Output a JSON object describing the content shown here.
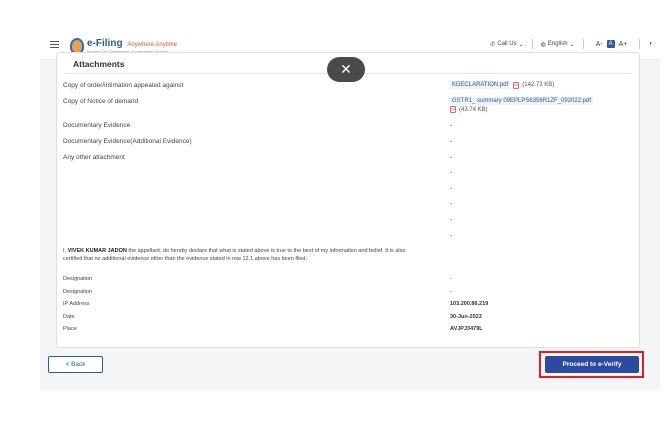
{
  "header": {
    "logo_title": "e-Filing",
    "logo_tagline": "Anywhere Anytime",
    "logo_subtitle": "Income Tax Department, Government of India",
    "call_us": "Call Us",
    "language": "English",
    "font_decrease": "A-",
    "font_normal": "A",
    "font_increase": "A+"
  },
  "card": {
    "title": "Attachments"
  },
  "attachments": [
    {
      "label": "Copy of order/intimation appealed against",
      "file": "KDECLARATION.pdf",
      "size": "(142.73 KB)"
    },
    {
      "label": "Copy of Notice of demand",
      "file": "GSTR1_ summary 09EPLPS6356R1ZF_092022.pdf",
      "size": "(43.74 KB)"
    },
    {
      "label": "Documentary Evidence",
      "value": "-"
    },
    {
      "label": "Documentary Evidence(Additional Evidence)",
      "value": "-"
    },
    {
      "label": "Any other attachment",
      "value": "-"
    }
  ],
  "extra_dashes": [
    "-",
    "-",
    "-",
    "-",
    "-",
    "-"
  ],
  "declaration": {
    "prefix": "I, ",
    "name": "VIVEK KUMAR JADON",
    "text": " the appellant, do hereby declare that what is stated above is true to the best of my information and belief. It is also certified that no additional evidence other than the evidence stated in row 12.1 above has been filed."
  },
  "details": [
    {
      "label": "Designation",
      "value": "-"
    },
    {
      "label": "Designation",
      "value": "-"
    },
    {
      "label": "IP Address",
      "value": "103.200.86.219"
    },
    {
      "label": "Date",
      "value": "30-Jun-2023"
    },
    {
      "label": "Place",
      "value": "AVJPJ3479L"
    }
  ],
  "actions": {
    "back_label": "< Back",
    "proceed_label": "Proceed to e-Verify"
  },
  "close_symbol": "✕"
}
